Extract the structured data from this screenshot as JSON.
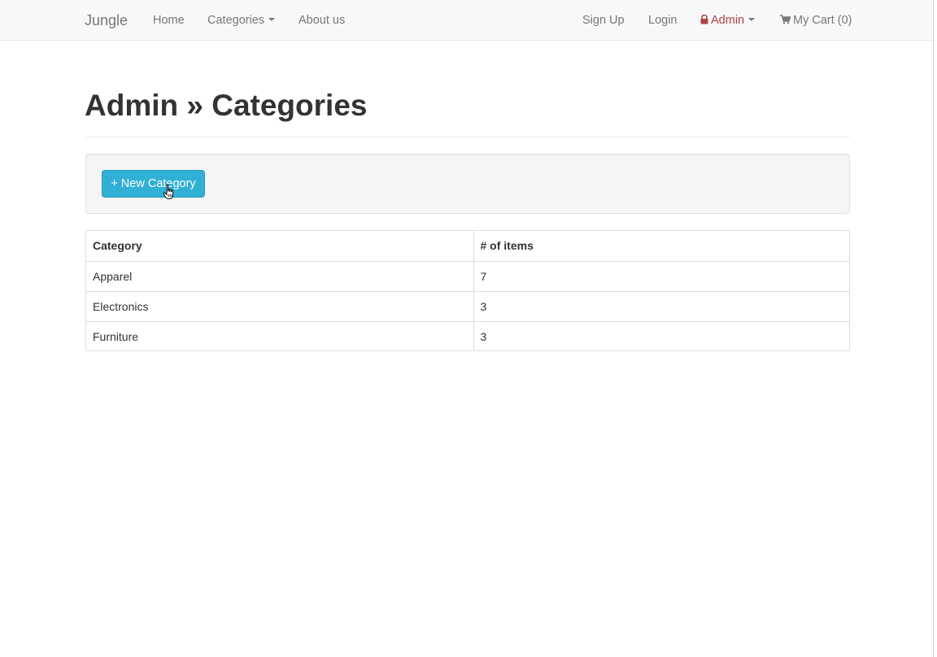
{
  "navbar": {
    "brand": "Jungle",
    "home": "Home",
    "categories": "Categories",
    "about": "About us",
    "signup": "Sign Up",
    "login": "Login",
    "admin": "Admin",
    "cart": "My Cart (0)",
    "admin_color": "#a94442",
    "icons": {
      "admin": "lock-icon",
      "cart": "shopping-cart-icon",
      "dropdown": "caret-down-icon"
    }
  },
  "page": {
    "title": "Admin » Categories"
  },
  "toolbar": {
    "new_category_label": "+ New Category",
    "button_color": "#31b0d5"
  },
  "table": {
    "headers": [
      "Category",
      "# of items"
    ],
    "rows": [
      [
        "Apparel",
        "7"
      ],
      [
        "Electronics",
        "3"
      ],
      [
        "Furniture",
        "3"
      ]
    ]
  }
}
